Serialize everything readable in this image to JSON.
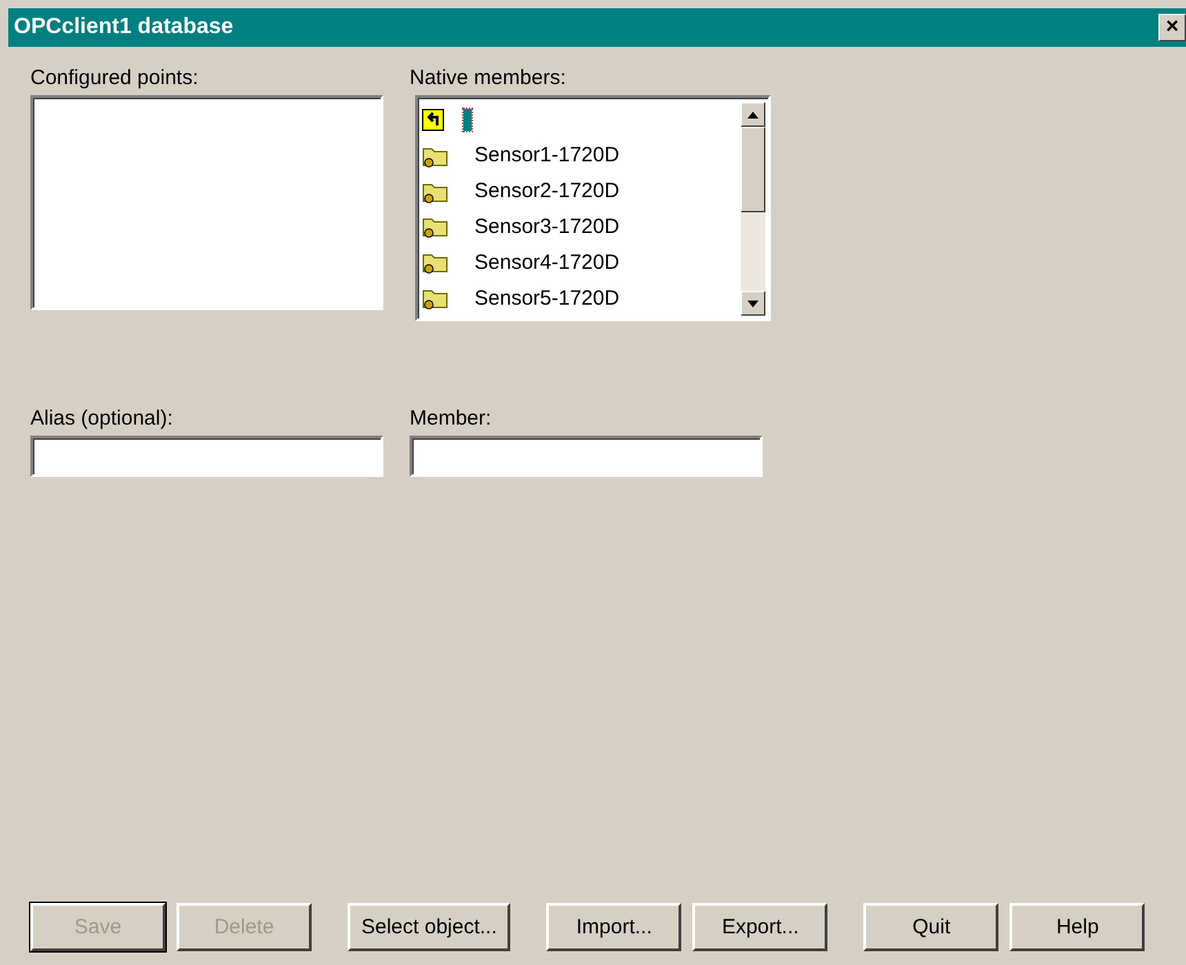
{
  "window": {
    "title": "OPCclient1 database",
    "close": "×"
  },
  "configured_points": {
    "label": "Configured points:"
  },
  "native_members": {
    "label": "Native members:",
    "items": [
      {
        "kind": "up",
        "selected": true
      },
      {
        "kind": "folder",
        "name": "Sensor1-1720D",
        "selected": false
      },
      {
        "kind": "folder",
        "name": "Sensor2-1720D",
        "selected": false
      },
      {
        "kind": "folder",
        "name": "Sensor3-1720D",
        "selected": false
      },
      {
        "kind": "folder",
        "name": "Sensor4-1720D",
        "selected": false
      },
      {
        "kind": "folder",
        "name": "Sensor5-1720D",
        "selected": false
      }
    ]
  },
  "alias": {
    "label": "Alias (optional):"
  },
  "member": {
    "label": "Member:"
  },
  "buttons": [
    {
      "label": "Save",
      "disabled": true,
      "default": true
    },
    {
      "label": "Delete",
      "disabled": true,
      "default": false
    },
    {
      "label": "Select object...",
      "disabled": false,
      "default": false
    },
    {
      "label": "Import...",
      "disabled": false,
      "default": false
    },
    {
      "label": "Export...",
      "disabled": false,
      "default": false
    },
    {
      "label": "Quit",
      "disabled": false,
      "default": false
    },
    {
      "label": "Help",
      "disabled": false,
      "default": false
    }
  ]
}
